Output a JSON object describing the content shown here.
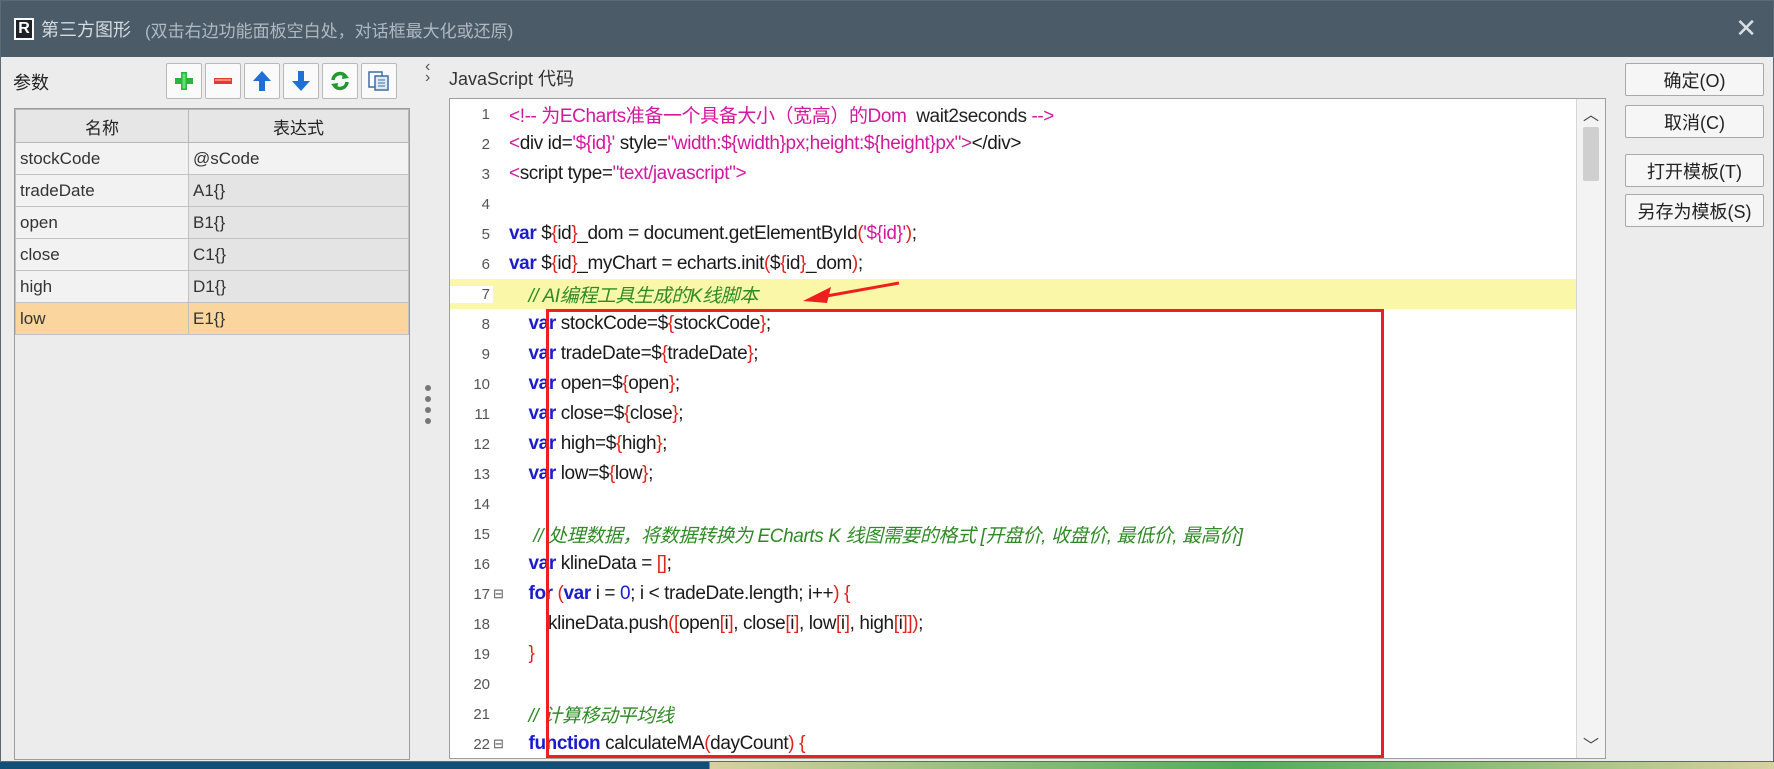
{
  "dialog": {
    "title": "第三方图形",
    "hint": "(双击右边功能面板空白处，对话框最大化或还原)",
    "close_label": "✕"
  },
  "params": {
    "label": "参数",
    "toolbar": {
      "add": "add-icon",
      "remove": "remove-icon",
      "move_up": "arrow-up-icon",
      "move_down": "arrow-down-icon",
      "refresh": "refresh-icon",
      "copy": "copy-icon"
    },
    "columns": [
      "名称",
      "表达式"
    ],
    "rows": [
      {
        "name": "stockCode",
        "expr": "@sCode"
      },
      {
        "name": "tradeDate",
        "expr": "A1{}"
      },
      {
        "name": "open",
        "expr": "B1{}"
      },
      {
        "name": "close",
        "expr": "C1{}"
      },
      {
        "name": "high",
        "expr": "D1{}"
      },
      {
        "name": "low",
        "expr": "E1{}"
      }
    ]
  },
  "editor": {
    "label": "JavaScript 代码",
    "lines": [
      {
        "n": "1",
        "fold": "",
        "text": "<!-- 为ECharts准备一个具备大小（宽高）的Dom  wait2seconds -->"
      },
      {
        "n": "2",
        "fold": "",
        "text": "<div id='${id}' style=\"width:${width}px;height:${height}px\"></div>"
      },
      {
        "n": "3",
        "fold": "",
        "text": "<script type=\"text/javascript\">"
      },
      {
        "n": "4",
        "fold": "",
        "text": ""
      },
      {
        "n": "5",
        "fold": "",
        "text": "var ${id}_dom = document.getElementById('${id}');"
      },
      {
        "n": "6",
        "fold": "",
        "text": "var ${id}_myChart = echarts.init(${id}_dom);"
      },
      {
        "n": "7",
        "fold": "",
        "text": "    // AI编程工具生成的K线脚本"
      },
      {
        "n": "8",
        "fold": "",
        "text": "    var stockCode=${stockCode};"
      },
      {
        "n": "9",
        "fold": "",
        "text": "    var tradeDate=${tradeDate};"
      },
      {
        "n": "10",
        "fold": "",
        "text": "    var open=${open};"
      },
      {
        "n": "11",
        "fold": "",
        "text": "    var close=${close};"
      },
      {
        "n": "12",
        "fold": "",
        "text": "    var high=${high};"
      },
      {
        "n": "13",
        "fold": "",
        "text": "    var low=${low};"
      },
      {
        "n": "14",
        "fold": "",
        "text": ""
      },
      {
        "n": "15",
        "fold": "",
        "text": "     // 处理数据，将数据转换为 ECharts K 线图需要的格式 [开盘价, 收盘价, 最低价, 最高价]"
      },
      {
        "n": "16",
        "fold": "",
        "text": "    var klineData = [];"
      },
      {
        "n": "17",
        "fold": "⊟",
        "text": "    for (var i = 0; i < tradeDate.length; i++) {"
      },
      {
        "n": "18",
        "fold": "",
        "text": "        klineData.push([open[i], close[i], low[i], high[i]]);"
      },
      {
        "n": "19",
        "fold": "",
        "text": "    }"
      },
      {
        "n": "20",
        "fold": "",
        "text": ""
      },
      {
        "n": "21",
        "fold": "",
        "text": "    // 计算移动平均线"
      },
      {
        "n": "22",
        "fold": "⊟",
        "text": "    function calculateMA(dayCount) {"
      }
    ]
  },
  "buttons": {
    "ok": "确定(O)",
    "cancel": "取消(C)",
    "open_template": "打开模板(T)",
    "save_template": "另存为模板(S)"
  },
  "colors": {
    "titlebar": "#4b5b68",
    "keyword": "#1c1ccf",
    "string": "#d4189e",
    "comment": "#2f8a26",
    "highlight_line": "#fbf7a8",
    "selected_row": "#fbd59e",
    "annotation_red": "#f01e1e"
  }
}
